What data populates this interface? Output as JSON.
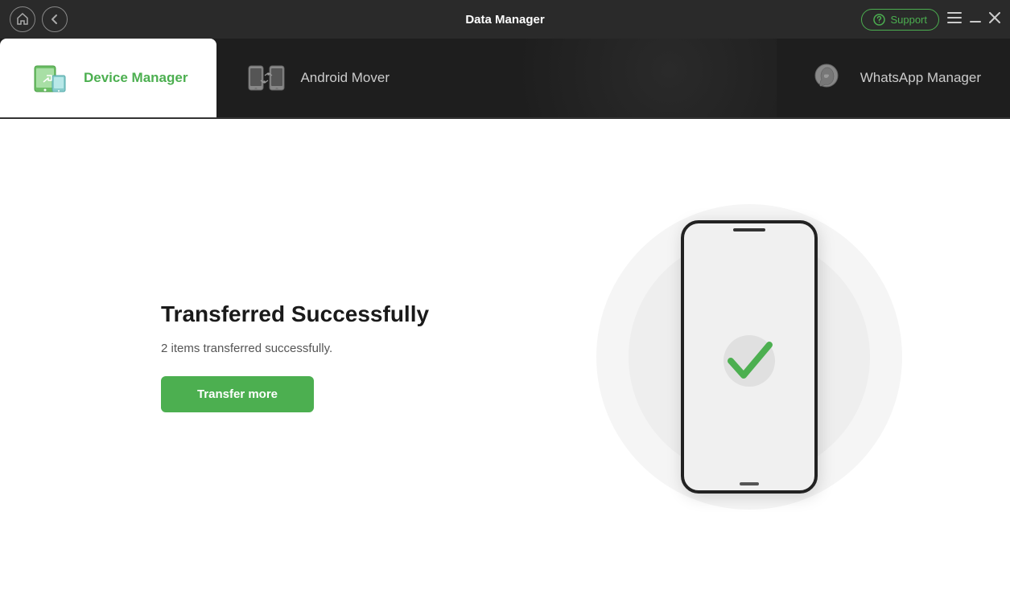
{
  "titlebar": {
    "title": "Data Manager",
    "support_label": "Support",
    "back_label": "‹"
  },
  "nav": {
    "tabs": [
      {
        "id": "device-manager",
        "label": "Device Manager",
        "active": true
      },
      {
        "id": "android-mover",
        "label": "Android Mover",
        "active": false
      },
      {
        "id": "whatsapp-manager",
        "label": "WhatsApp Manager",
        "active": false
      }
    ]
  },
  "main": {
    "success_title": "Transferred Successfully",
    "success_sub": "2 items transferred successfully.",
    "transfer_more_label": "Transfer more"
  },
  "colors": {
    "accent": "#4caf50",
    "dark_bg": "#1e1e1e",
    "titlebar_bg": "#2a2a2a"
  }
}
